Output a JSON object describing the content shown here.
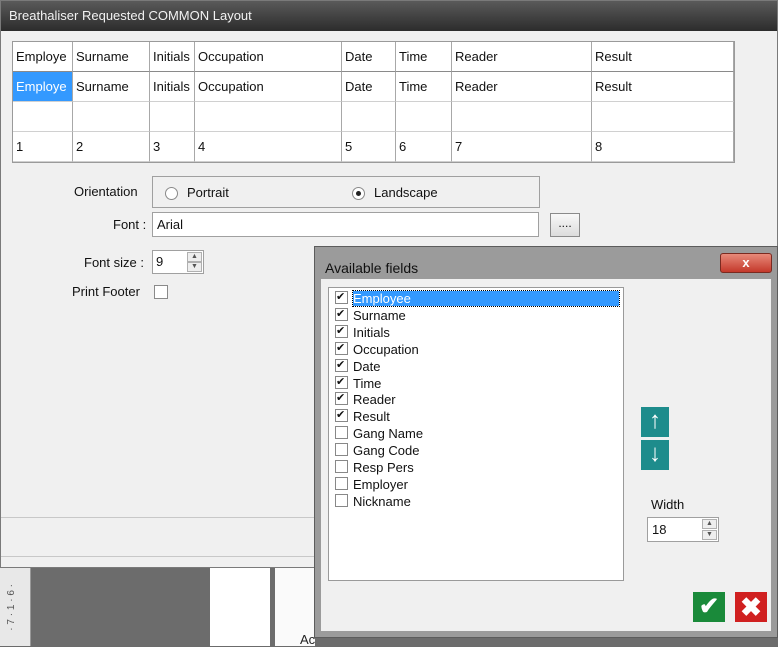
{
  "window": {
    "title": "Breathaliser Requested COMMON Layout"
  },
  "grid": {
    "headers": [
      "Employe",
      "Surname",
      "Initials",
      "Occupation",
      "Date",
      "Time",
      "Reader",
      "Result"
    ],
    "field_row": [
      "Employe",
      "Surname",
      "Initials",
      "Occupation",
      "Date",
      "Time",
      "Reader",
      "Result"
    ],
    "number_row": [
      "1",
      "2",
      "3",
      "4",
      "5",
      "6",
      "7",
      "8"
    ]
  },
  "settings": {
    "orientation_label": "Orientation",
    "portrait_label": "Portrait",
    "landscape_label": "Landscape",
    "orientation_selected": "Landscape",
    "font_label": "Font :",
    "font_value": "Arial",
    "font_button": "....",
    "font_size_label": "Font size :",
    "font_size_value": "9",
    "print_footer_label": "Print Footer",
    "print_footer_checked": false
  },
  "background": {
    "partial_text": "Ac"
  },
  "dialog": {
    "title": "Available fields",
    "close_label": "x",
    "fields": [
      {
        "label": "Employee",
        "checked": true
      },
      {
        "label": "Surname",
        "checked": true
      },
      {
        "label": "Initials",
        "checked": true
      },
      {
        "label": "Occupation",
        "checked": true
      },
      {
        "label": "Date",
        "checked": true
      },
      {
        "label": "Time",
        "checked": true
      },
      {
        "label": "Reader",
        "checked": true
      },
      {
        "label": "Result",
        "checked": true
      },
      {
        "label": "Gang Name",
        "checked": false
      },
      {
        "label": "Gang Code",
        "checked": false
      },
      {
        "label": "Resp Pers",
        "checked": false
      },
      {
        "label": "Employer",
        "checked": false
      },
      {
        "label": "Nickname",
        "checked": false
      }
    ],
    "focused_field": "Employee",
    "move_up_icon": "arrow-up-icon",
    "move_down_icon": "arrow-down-icon",
    "width_label": "Width",
    "width_value": "18",
    "ok_icon": "checkmark-icon",
    "cancel_icon": "x-icon",
    "colors": {
      "ok": "#1a8a3a",
      "cancel": "#d02020",
      "arrows": "#1e8c8c",
      "selection": "#3399ff"
    }
  }
}
